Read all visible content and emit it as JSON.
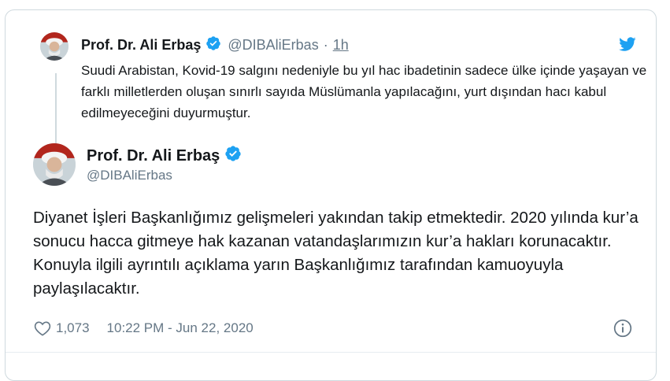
{
  "parent_tweet": {
    "author_name": "Prof. Dr. Ali Erbaş",
    "handle": "@DIBAliErbas",
    "separator": "·",
    "time": "1h",
    "text": "Suudi Arabistan, Kovid-19 salgını nedeniyle bu yıl hac ibadetinin sadece ülke içinde yaşayan ve farklı milletlerden oluşan sınırlı sayıda Müslümanla yapılacağını, yurt dışından hacı kabul edilmeyeceğini duyurmuştur."
  },
  "main_tweet": {
    "author_name": "Prof. Dr. Ali Erbaş",
    "handle": "@DIBAliErbas",
    "text": "Diyanet İşleri Başkanlığımız gelişmeleri yakından takip etmektedir. 2020 yılında kur’a sonucu hacca gitmeye hak kazanan vatandaşlarımızın kur’a hakları korunacaktır. Konuyla ilgili ayrıntılı açıklama yarın Başkanlığımız tarafından kamuoyuyla paylaşılacaktır.",
    "like_count": "1,073",
    "timestamp": "10:22 PM - Jun 22, 2020"
  },
  "icons": {
    "verified": "verified-badge-icon",
    "twitter": "twitter-bird-icon",
    "like": "heart-icon",
    "info": "info-icon"
  },
  "colors": {
    "verified": "#1da1f2",
    "twitter_blue": "#1da1f2",
    "secondary_text": "#657786",
    "border": "#cfd9de"
  }
}
